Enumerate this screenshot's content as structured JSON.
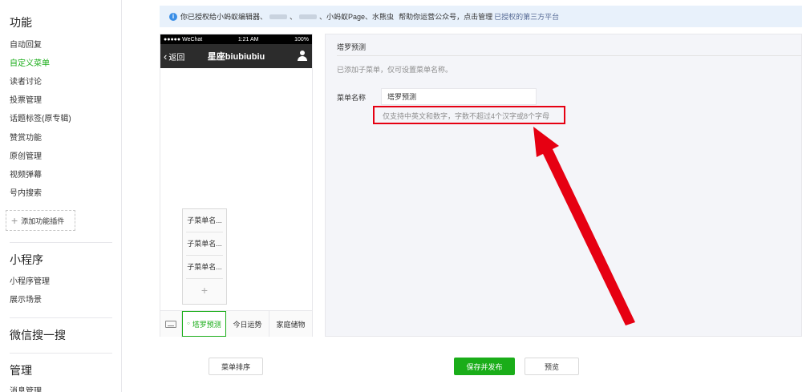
{
  "sidebar": {
    "sections": [
      {
        "title": "功能",
        "icon": "function-icon"
      },
      {
        "title": "小程序",
        "icon": "mini-program-icon"
      },
      {
        "title": "微信搜一搜",
        "icon": "search-icon"
      },
      {
        "title": "管理",
        "icon": "manage-icon"
      }
    ],
    "function_items": [
      "自动回复",
      "自定义菜单",
      "读者讨论",
      "投票管理",
      "话题标签(原专辑)",
      "赞赏功能",
      "原创管理",
      "视频弹幕",
      "号内搜索"
    ],
    "add_plugin_label": "添加功能插件",
    "mini_items": [
      "小程序管理",
      "展示场景"
    ],
    "manage_items": [
      "消息管理"
    ]
  },
  "notice": {
    "prefix": "你已授权给小蚂蚁编辑器、",
    "separator": "、",
    "middle": "、小蚂蚁Page、水熊虫",
    "suffix": "帮助你运营公众号，点击管理",
    "link": "已授权的第三方平台"
  },
  "phone": {
    "carrier": "●●●●● WeChat",
    "time": "1:21 AM",
    "battery": "100%",
    "back_label": "返回",
    "title": "星座biubiubiu",
    "sub_menu": [
      "子菜单名...",
      "子菜单名...",
      "子菜单名..."
    ],
    "sub_add": "+",
    "menu": [
      "塔罗预测",
      "今日运势",
      "家庭储物"
    ]
  },
  "editor": {
    "title": "塔罗预测",
    "hint": "已添加子菜单，仅可设置菜单名称。",
    "field_label": "菜单名称",
    "field_value": "塔罗预测",
    "field_tip": "仅支持中英文和数字，字数不超过4个汉字或8个字母"
  },
  "buttons": {
    "sort": "菜单排序",
    "save": "保存并发布",
    "preview": "预览"
  },
  "colors": {
    "accent_green": "#1aad19",
    "annotation_red": "#e60012",
    "notice_bg": "#e8f1fb",
    "link": "#576b95"
  }
}
